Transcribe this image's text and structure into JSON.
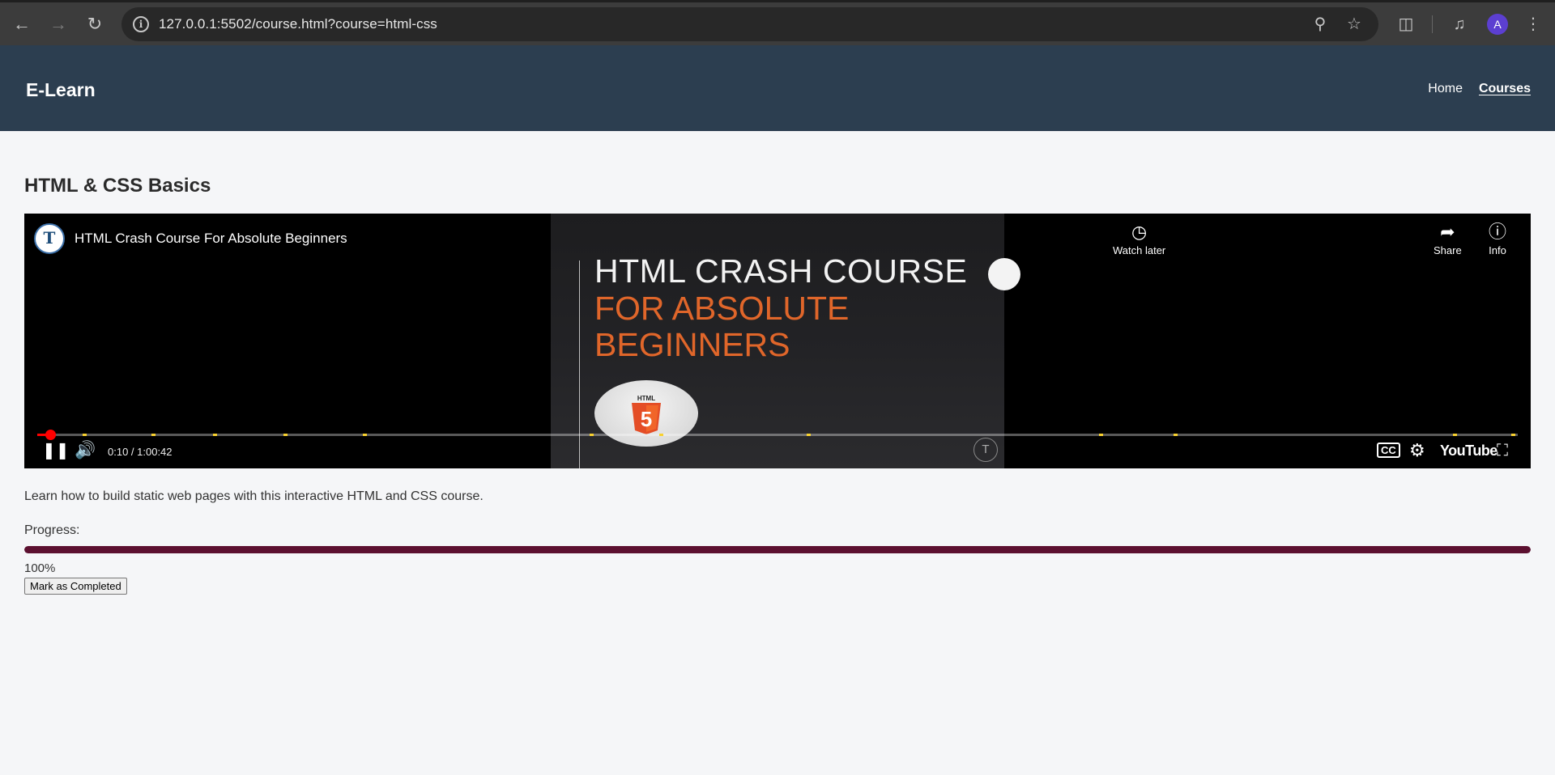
{
  "browser": {
    "url": "127.0.0.1:5502/course.html?course=html-css",
    "profile_initial": "A",
    "icons": [
      "back-icon",
      "forward-icon",
      "reload-icon",
      "site-info-icon",
      "zoom-icon",
      "bookmark-star-icon",
      "extensions-icon",
      "media-control-icon",
      "menu-icon"
    ]
  },
  "site": {
    "brand": "E-Learn",
    "nav": {
      "home": "Home",
      "courses": "Courses",
      "active": "Courses"
    }
  },
  "course": {
    "title": "HTML & CSS Basics",
    "description": "Learn how to build static web pages with this interactive HTML and CSS course.",
    "progress_label": "Progress:",
    "progress_value": "100%",
    "progress_fraction": 1.0,
    "complete_button": "Mark as Completed"
  },
  "video": {
    "title": "HTML Crash Course For Absolute Beginners",
    "channel_initial": "T",
    "thumbnail": {
      "line1": "HTML CRASH COURSE",
      "line2": "FOR ABSOLUTE",
      "line3": "BEGINNERS",
      "logo_text": "HTML"
    },
    "top_buttons": {
      "watch_later": "Watch later",
      "share": "Share",
      "info": "Info"
    },
    "time": "0:10 / 1:00:42",
    "elapsed_fraction": 0.003,
    "brand": "YouTube",
    "colors": {
      "played": "#ff0000",
      "chapter": "#f8d12f",
      "accent_orange": "#e0662a"
    }
  }
}
